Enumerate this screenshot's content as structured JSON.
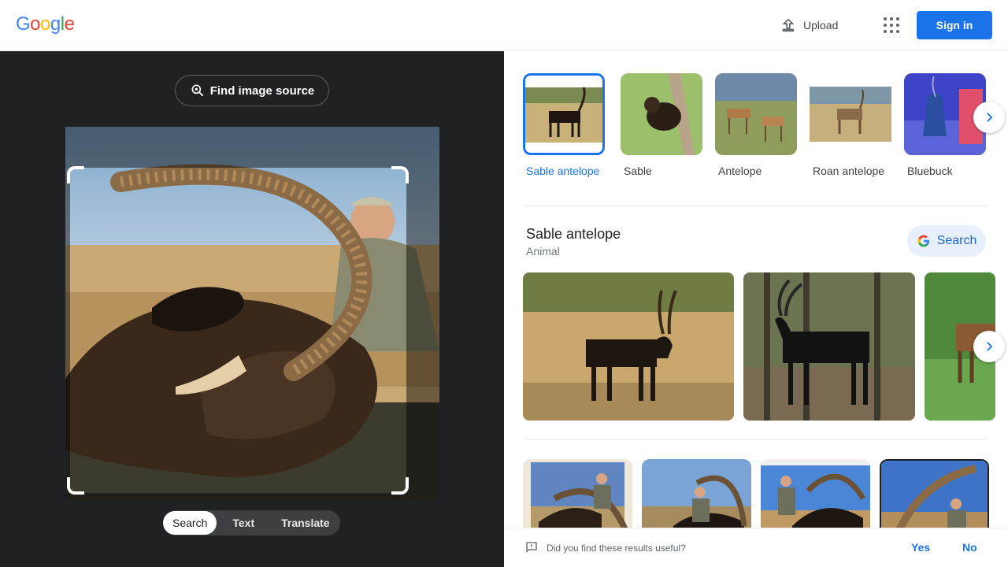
{
  "header": {
    "logo_letters": [
      "G",
      "o",
      "o",
      "g",
      "l",
      "e"
    ],
    "upload_label": "Upload",
    "signin_label": "Sign in"
  },
  "left_panel": {
    "find_source_label": "Find image source",
    "mode_tabs": [
      {
        "label": "Search",
        "active": true
      },
      {
        "label": "Text",
        "active": false
      },
      {
        "label": "Translate",
        "active": false
      }
    ]
  },
  "suggestions": [
    {
      "label": "Sable antelope",
      "selected": true
    },
    {
      "label": "Sable",
      "selected": false
    },
    {
      "label": "Antelope",
      "selected": false
    },
    {
      "label": "Roan antelope",
      "selected": false
    },
    {
      "label": "Bluebuck",
      "selected": false
    }
  ],
  "entity": {
    "title": "Sable antelope",
    "subtitle": "Animal",
    "search_label": "Search"
  },
  "feedback": {
    "question": "Did you find these results useful?",
    "yes": "Yes",
    "no": "No"
  },
  "colors": {
    "accent": "#1a73e8",
    "logo": [
      "#4285f4",
      "#ea4335",
      "#fbbc05",
      "#4285f4",
      "#34a853",
      "#ea4335"
    ],
    "dark_panel": "#202124"
  },
  "icons": [
    "upload-icon",
    "apps-grid-icon",
    "lens-search-icon",
    "chevron-right-icon",
    "google-g-icon",
    "feedback-icon"
  ]
}
